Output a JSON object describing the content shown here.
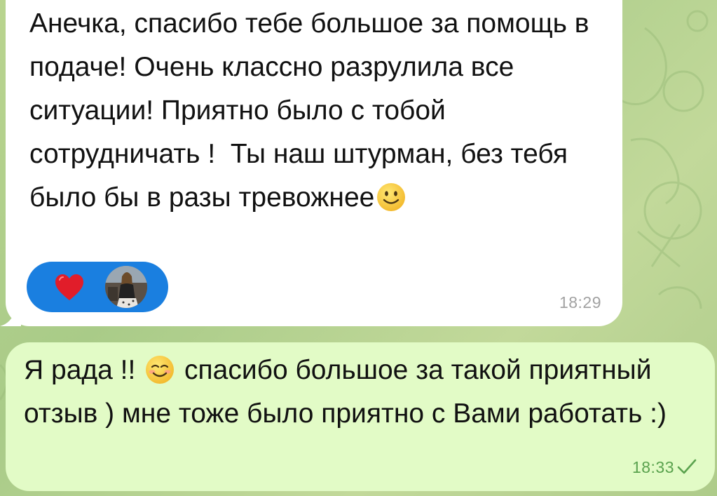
{
  "incoming_message": {
    "text_before_emoji": "Анечка, спасибо тебе большое за помощь в подаче! Очень классно разрулила все ситуации! Приятно было с тобой сотрудничать !  Ты наш штурман, без тебя было бы в разы тревожнее",
    "emoji": "slightly-smiling-face",
    "time": "18:29",
    "reaction": {
      "emoji": "red-heart",
      "reactor": "avatar",
      "pill_color": "#1a7fe0"
    }
  },
  "outgoing_message": {
    "text_before_emoji": "Я рада !! ",
    "emoji": "smiling-face",
    "text_after_emoji": " спасибо большое за такой приятный отзыв ) мне тоже было приятно с Вами работать :)",
    "time": "18:33",
    "status": "sent-check-icon"
  },
  "colors": {
    "incoming_bubble": "#ffffff",
    "outgoing_bubble": "#e2fbc6",
    "outgoing_time": "#5aa24e",
    "wallpaper": "#b9d48f"
  }
}
